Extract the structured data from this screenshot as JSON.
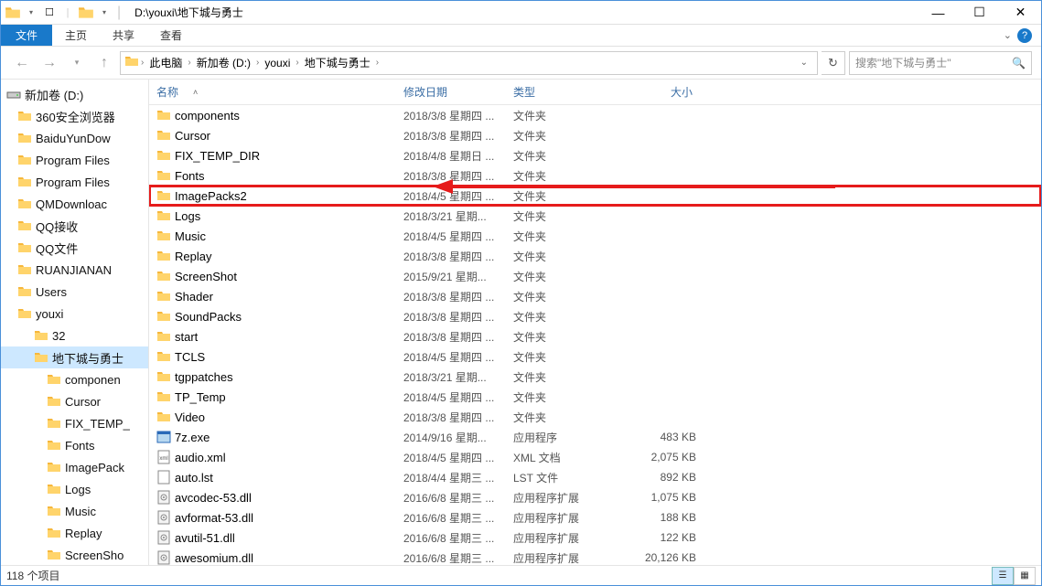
{
  "titlebar": {
    "path": "D:\\youxi\\地下城与勇士"
  },
  "ribbon": {
    "file": "文件",
    "home": "主页",
    "share": "共享",
    "view": "查看"
  },
  "breadcrumb": {
    "segments": [
      "此电脑",
      "新加卷 (D:)",
      "youxi",
      "地下城与勇士"
    ]
  },
  "search": {
    "placeholder": "搜索\"地下城与勇士\""
  },
  "headers": {
    "name": "名称",
    "date": "修改日期",
    "type": "类型",
    "size": "大小"
  },
  "tree": {
    "root": "新加卷 (D:)",
    "items": [
      {
        "label": "360安全浏览器",
        "lvl": 1
      },
      {
        "label": "BaiduYunDow",
        "lvl": 1
      },
      {
        "label": "Program Files",
        "lvl": 1
      },
      {
        "label": "Program Files",
        "lvl": 1
      },
      {
        "label": "QMDownloac",
        "lvl": 1
      },
      {
        "label": "QQ接收",
        "lvl": 1
      },
      {
        "label": "QQ文件",
        "lvl": 1
      },
      {
        "label": "RUANJIANAN",
        "lvl": 1
      },
      {
        "label": "Users",
        "lvl": 1
      },
      {
        "label": "youxi",
        "lvl": 1
      },
      {
        "label": "32",
        "lvl": 2
      },
      {
        "label": "地下城与勇士",
        "lvl": 2,
        "sel": true
      },
      {
        "label": "componen",
        "lvl": 3
      },
      {
        "label": "Cursor",
        "lvl": 3
      },
      {
        "label": "FIX_TEMP_",
        "lvl": 3
      },
      {
        "label": "Fonts",
        "lvl": 3
      },
      {
        "label": "ImagePack",
        "lvl": 3
      },
      {
        "label": "Logs",
        "lvl": 3
      },
      {
        "label": "Music",
        "lvl": 3
      },
      {
        "label": "Replay",
        "lvl": 3
      },
      {
        "label": "ScreenSho",
        "lvl": 3
      }
    ]
  },
  "rows": [
    {
      "name": "components",
      "date": "2018/3/8 星期四 ...",
      "type": "文件夹",
      "size": "",
      "icon": "folder"
    },
    {
      "name": "Cursor",
      "date": "2018/3/8 星期四 ...",
      "type": "文件夹",
      "size": "",
      "icon": "folder"
    },
    {
      "name": "FIX_TEMP_DIR",
      "date": "2018/4/8 星期日 ...",
      "type": "文件夹",
      "size": "",
      "icon": "folder"
    },
    {
      "name": "Fonts",
      "date": "2018/3/8 星期四 ...",
      "type": "文件夹",
      "size": "",
      "icon": "folder"
    },
    {
      "name": "ImagePacks2",
      "date": "2018/4/5 星期四 ...",
      "type": "文件夹",
      "size": "",
      "icon": "folder",
      "highlight": true
    },
    {
      "name": "Logs",
      "date": "2018/3/21 星期...",
      "type": "文件夹",
      "size": "",
      "icon": "folder"
    },
    {
      "name": "Music",
      "date": "2018/4/5 星期四 ...",
      "type": "文件夹",
      "size": "",
      "icon": "folder"
    },
    {
      "name": "Replay",
      "date": "2018/3/8 星期四 ...",
      "type": "文件夹",
      "size": "",
      "icon": "folder"
    },
    {
      "name": "ScreenShot",
      "date": "2015/9/21 星期...",
      "type": "文件夹",
      "size": "",
      "icon": "folder"
    },
    {
      "name": "Shader",
      "date": "2018/3/8 星期四 ...",
      "type": "文件夹",
      "size": "",
      "icon": "folder"
    },
    {
      "name": "SoundPacks",
      "date": "2018/3/8 星期四 ...",
      "type": "文件夹",
      "size": "",
      "icon": "folder"
    },
    {
      "name": "start",
      "date": "2018/3/8 星期四 ...",
      "type": "文件夹",
      "size": "",
      "icon": "folder"
    },
    {
      "name": "TCLS",
      "date": "2018/4/5 星期四 ...",
      "type": "文件夹",
      "size": "",
      "icon": "folder"
    },
    {
      "name": "tgppatches",
      "date": "2018/3/21 星期...",
      "type": "文件夹",
      "size": "",
      "icon": "folder"
    },
    {
      "name": "TP_Temp",
      "date": "2018/4/5 星期四 ...",
      "type": "文件夹",
      "size": "",
      "icon": "folder"
    },
    {
      "name": "Video",
      "date": "2018/3/8 星期四 ...",
      "type": "文件夹",
      "size": "",
      "icon": "folder"
    },
    {
      "name": "7z.exe",
      "date": "2014/9/16 星期...",
      "type": "应用程序",
      "size": "483 KB",
      "icon": "exe"
    },
    {
      "name": "audio.xml",
      "date": "2018/4/5 星期四 ...",
      "type": "XML 文档",
      "size": "2,075 KB",
      "icon": "xml"
    },
    {
      "name": "auto.lst",
      "date": "2018/4/4 星期三 ...",
      "type": "LST 文件",
      "size": "892 KB",
      "icon": "file"
    },
    {
      "name": "avcodec-53.dll",
      "date": "2016/6/8 星期三 ...",
      "type": "应用程序扩展",
      "size": "1,075 KB",
      "icon": "dll"
    },
    {
      "name": "avformat-53.dll",
      "date": "2016/6/8 星期三 ...",
      "type": "应用程序扩展",
      "size": "188 KB",
      "icon": "dll"
    },
    {
      "name": "avutil-51.dll",
      "date": "2016/6/8 星期三 ...",
      "type": "应用程序扩展",
      "size": "122 KB",
      "icon": "dll"
    },
    {
      "name": "awesomium.dll",
      "date": "2016/6/8 星期三 ...",
      "type": "应用程序扩展",
      "size": "20,126 KB",
      "icon": "dll"
    }
  ],
  "status": {
    "text": "118 个项目"
  }
}
